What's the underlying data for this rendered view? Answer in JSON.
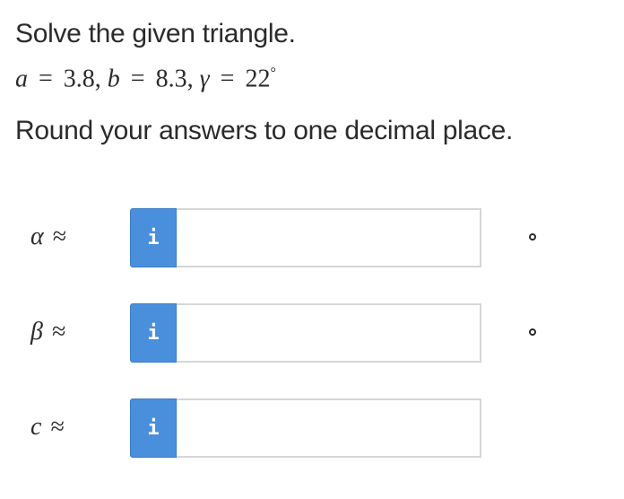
{
  "prompt": {
    "title": "Solve the given triangle.",
    "given": {
      "a_var": "a",
      "a_value": "3.8,",
      "b_var": "b",
      "b_value": "8.3,",
      "gamma_var": "γ",
      "gamma_value": "22",
      "gamma_unit": "°",
      "equals": "="
    },
    "instruction": "Round your answers to one decimal place."
  },
  "answers": [
    {
      "symbol": "α",
      "approx": "≈",
      "info_label": "i",
      "value": "",
      "unit": "degree"
    },
    {
      "symbol": "β",
      "approx": "≈",
      "info_label": "i",
      "value": "",
      "unit": "degree"
    },
    {
      "symbol": "c",
      "approx": "≈",
      "info_label": "i",
      "value": ""
    }
  ],
  "colors": {
    "info_button": "#4a8fdb",
    "input_border": "#d6d6d6",
    "text": "#2b2b2b"
  }
}
